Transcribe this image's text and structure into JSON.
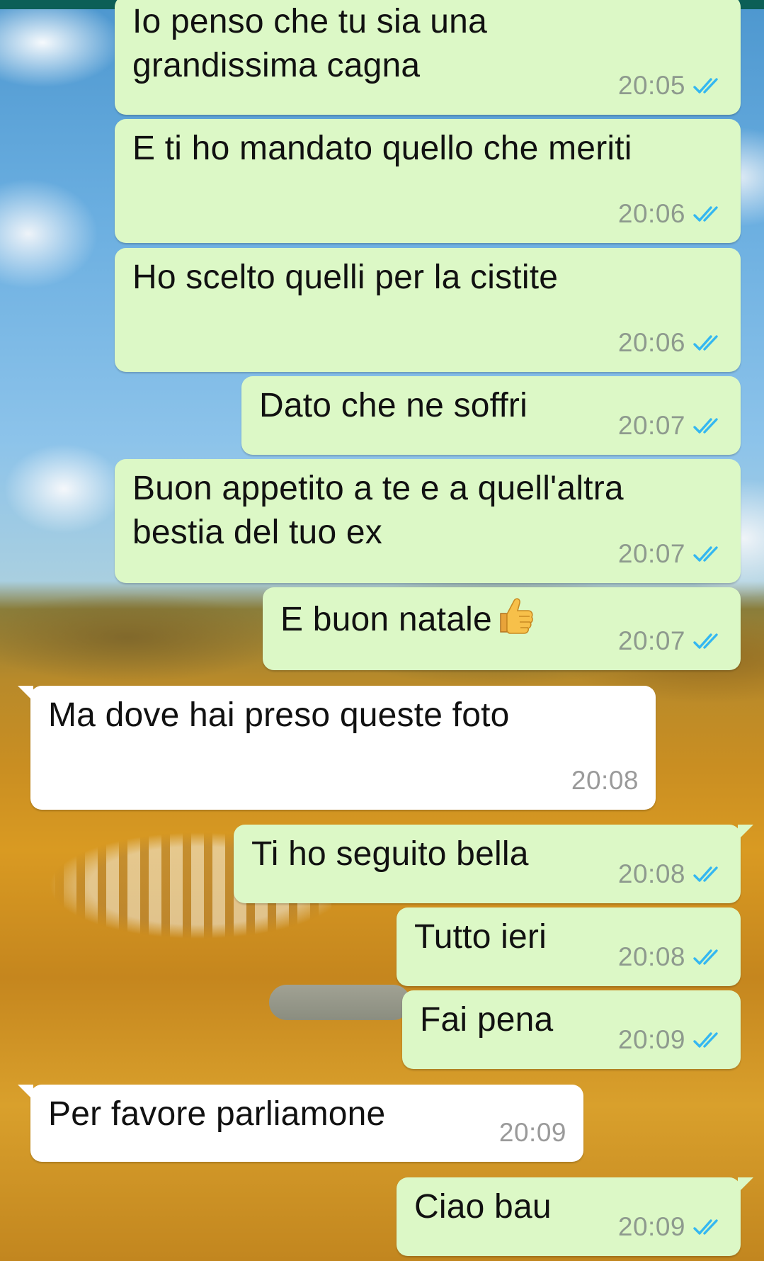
{
  "colors": {
    "outgoing_bubble": "#dcf8c6",
    "incoming_bubble": "#ffffff",
    "read_ticks": "#34b7f1",
    "top_bar": "#0c5f57"
  },
  "messages": [
    {
      "dir": "out",
      "text": "Io penso che tu sia una\ngrandissima cagna",
      "time": "20:05",
      "status": "read"
    },
    {
      "dir": "out",
      "text": "E ti ho mandato quello che meriti",
      "time": "20:06",
      "status": "read"
    },
    {
      "dir": "out",
      "text": "Ho scelto quelli per la cistite",
      "time": "20:06",
      "status": "read"
    },
    {
      "dir": "out",
      "text": "Dato che ne soffri",
      "time": "20:07",
      "status": "read"
    },
    {
      "dir": "out",
      "text": "Buon appetito a te e a quell'altra\nbestia del tuo ex",
      "time": "20:07",
      "status": "read"
    },
    {
      "dir": "out",
      "text": "E buon natale",
      "emoji": "thumbs-up",
      "time": "20:07",
      "status": "read"
    },
    {
      "dir": "in",
      "text": "Ma dove hai preso queste foto",
      "time": "20:08"
    },
    {
      "dir": "out",
      "text": "Ti ho seguito bella",
      "time": "20:08",
      "status": "read"
    },
    {
      "dir": "out",
      "text": "Tutto ieri",
      "time": "20:08",
      "status": "read"
    },
    {
      "dir": "out",
      "text": "Fai pena",
      "time": "20:09",
      "status": "read"
    },
    {
      "dir": "in",
      "text": "Per favore parliamone",
      "time": "20:09"
    },
    {
      "dir": "out",
      "text": "Ciao bau",
      "time": "20:09",
      "status": "read"
    }
  ]
}
